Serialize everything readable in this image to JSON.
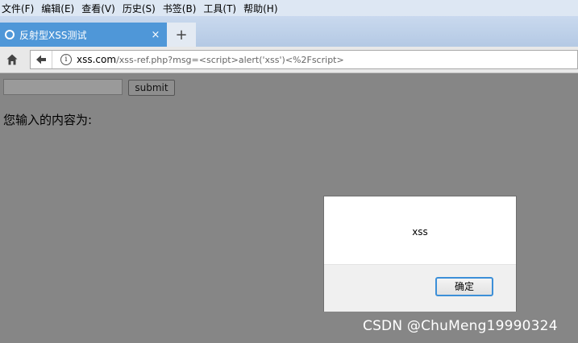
{
  "menubar": {
    "items": [
      "文件(F)",
      "编辑(E)",
      "查看(V)",
      "历史(S)",
      "书签(B)",
      "工具(T)",
      "帮助(H)"
    ]
  },
  "tab": {
    "title": "反射型XSS测试",
    "close_glyph": "×",
    "new_tab_glyph": "+"
  },
  "address_bar": {
    "host": "xss.com",
    "path": "/xss-ref.php?msg=<script>alert('xss')<%2Fscript>"
  },
  "page": {
    "input_value": "",
    "submit_label": "submit",
    "result_label": "您输入的内容为:"
  },
  "alert_dialog": {
    "message": "xss",
    "ok_label": "确定"
  },
  "watermark": "CSDN @ChuMeng19990324",
  "icons": {
    "tab": "loading-circle-icon",
    "home": "home-icon",
    "back": "back-arrow-icon",
    "info": "info-icon"
  },
  "colors": {
    "active_tab": "#4f97d8",
    "dialog_button_border": "#3c8fd8",
    "page_overlay": "#868686"
  }
}
